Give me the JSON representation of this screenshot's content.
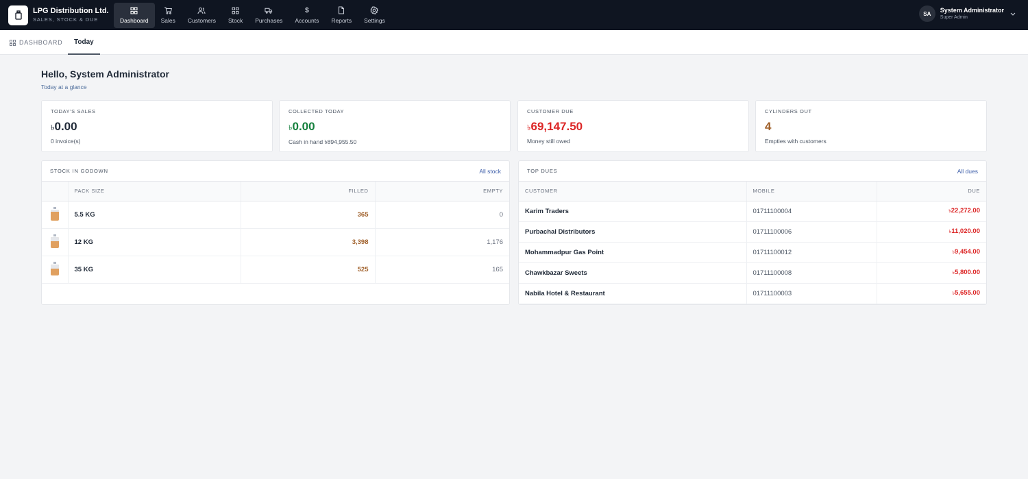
{
  "brand": {
    "name": "LPG Distribution Ltd.",
    "subtitle": "SALES, STOCK & DUE"
  },
  "nav": [
    {
      "label": "Dashboard",
      "icon": "grid-icon",
      "active": true
    },
    {
      "label": "Sales",
      "icon": "cart-icon",
      "active": false
    },
    {
      "label": "Customers",
      "icon": "users-icon",
      "active": false
    },
    {
      "label": "Stock",
      "icon": "boxes-icon",
      "active": false
    },
    {
      "label": "Purchases",
      "icon": "truck-icon",
      "active": false
    },
    {
      "label": "Accounts",
      "icon": "dollar-icon",
      "active": false
    },
    {
      "label": "Reports",
      "icon": "file-icon",
      "active": false
    },
    {
      "label": "Settings",
      "icon": "gear-icon",
      "active": false
    }
  ],
  "user": {
    "initials": "SA",
    "name": "System Administrator",
    "role": "Super Admin"
  },
  "breadcrumb": {
    "label": "DASHBOARD",
    "tab": "Today"
  },
  "greeting": {
    "title": "Hello, System Administrator",
    "subtitle": "Today at a glance"
  },
  "currency_symbol": "৳",
  "cards": [
    {
      "title": "TODAY'S SALES",
      "value": "0.00",
      "currency": true,
      "sub": "0 invoice(s)",
      "color": "#1f2937"
    },
    {
      "title": "COLLECTED TODAY",
      "value": "0.00",
      "currency": true,
      "sub": "Cash in hand ৳894,955.50",
      "color": "#15803d"
    },
    {
      "title": "CUSTOMER DUE",
      "value": "69,147.50",
      "currency": true,
      "sub": "Money still owed",
      "color": "#dc2626"
    },
    {
      "title": "CYLINDERS OUT",
      "value": "4",
      "currency": false,
      "sub": "Empties with customers",
      "color": "#a0602a"
    }
  ],
  "stock": {
    "title": "STOCK IN GODOWN",
    "link": "All stock",
    "columns": [
      "PACK SIZE",
      "FILLED",
      "EMPTY"
    ],
    "rows": [
      {
        "pack": "5.5 KG",
        "filled": "365",
        "empty": "0"
      },
      {
        "pack": "12 KG",
        "filled": "3,398",
        "empty": "1,176"
      },
      {
        "pack": "35 KG",
        "filled": "525",
        "empty": "165"
      }
    ]
  },
  "dues": {
    "title": "TOP DUES",
    "link": "All dues",
    "columns": [
      "CUSTOMER",
      "MOBILE",
      "DUE"
    ],
    "rows": [
      {
        "customer": "Karim Traders",
        "mobile": "01711100004",
        "due": "22,272.00"
      },
      {
        "customer": "Purbachal Distributors",
        "mobile": "01711100006",
        "due": "11,020.00"
      },
      {
        "customer": "Mohammadpur Gas Point",
        "mobile": "01711100012",
        "due": "9,454.00"
      },
      {
        "customer": "Chawkbazar Sweets",
        "mobile": "01711100008",
        "due": "5,800.00"
      },
      {
        "customer": "Nabila Hotel & Restaurant",
        "mobile": "01711100003",
        "due": "5,655.00"
      }
    ]
  }
}
